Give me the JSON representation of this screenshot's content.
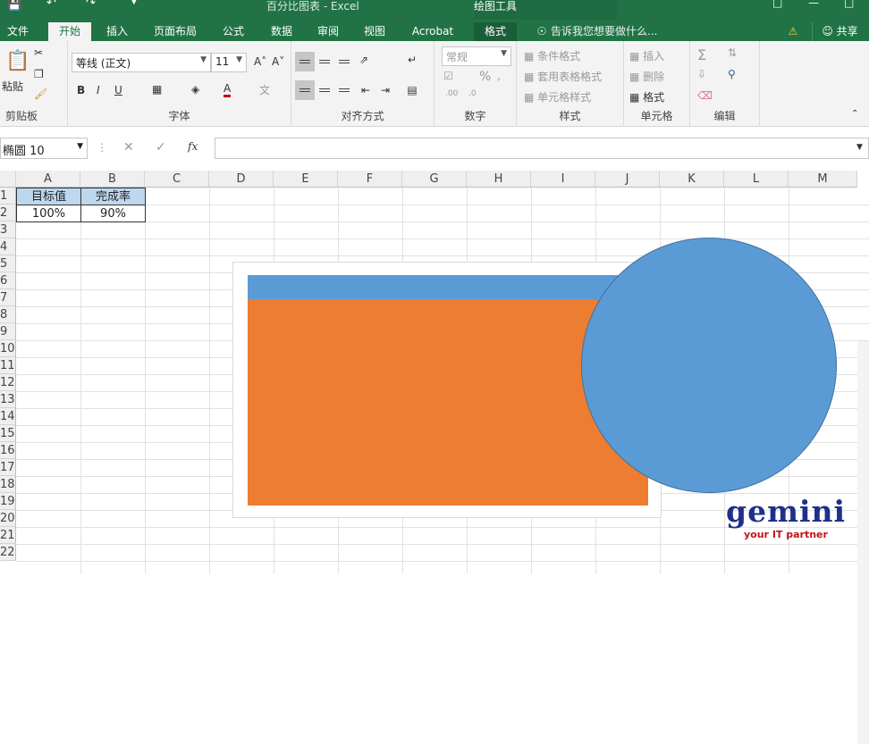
{
  "window": {
    "doc_title": "百分比图表 - Excel",
    "context_title": "绘图工具"
  },
  "tabs": [
    {
      "label": "文件"
    },
    {
      "label": "开始"
    },
    {
      "label": "插入"
    },
    {
      "label": "页面布局"
    },
    {
      "label": "公式"
    },
    {
      "label": "数据"
    },
    {
      "label": "审阅"
    },
    {
      "label": "视图"
    },
    {
      "label": "Acrobat"
    },
    {
      "label": "格式"
    }
  ],
  "tellme": "告诉我您想要做什么...",
  "share": "共享",
  "ribbon": {
    "clipboard": {
      "paste": "粘贴",
      "label": "剪贴板"
    },
    "font": {
      "name": "等线 (正文)",
      "size": "11",
      "label": "字体"
    },
    "alignment": {
      "label": "对齐方式"
    },
    "number": {
      "format": "常规",
      "label": "数字"
    },
    "styles": {
      "cond": "条件格式",
      "table": "套用表格格式",
      "cell": "单元格样式",
      "label": "样式"
    },
    "cells": {
      "insert": "插入",
      "delete": "删除",
      "format": "格式",
      "label": "单元格"
    },
    "editing": {
      "label": "编辑"
    }
  },
  "namebox": "椭圆 10",
  "fx": "fx",
  "columns": [
    "A",
    "B",
    "C",
    "D",
    "E",
    "F",
    "G",
    "H",
    "I",
    "J",
    "K",
    "L",
    "M"
  ],
  "rows": [
    "1",
    "2",
    "3",
    "4",
    "5",
    "6",
    "7",
    "8",
    "9",
    "10",
    "11",
    "12",
    "13",
    "14",
    "15",
    "16",
    "17",
    "18",
    "19",
    "20",
    "21",
    "22"
  ],
  "cells": {
    "a1": "目标值",
    "b1": "完成率",
    "a2": "100%",
    "b2": "90%"
  },
  "logo": {
    "word": "gemini",
    "tagline": "your IT partner"
  },
  "colors": {
    "excel_green": "#217346",
    "blue": "#5b9bd5",
    "orange": "#ed7d31",
    "header_fill": "#bdd7ee"
  }
}
